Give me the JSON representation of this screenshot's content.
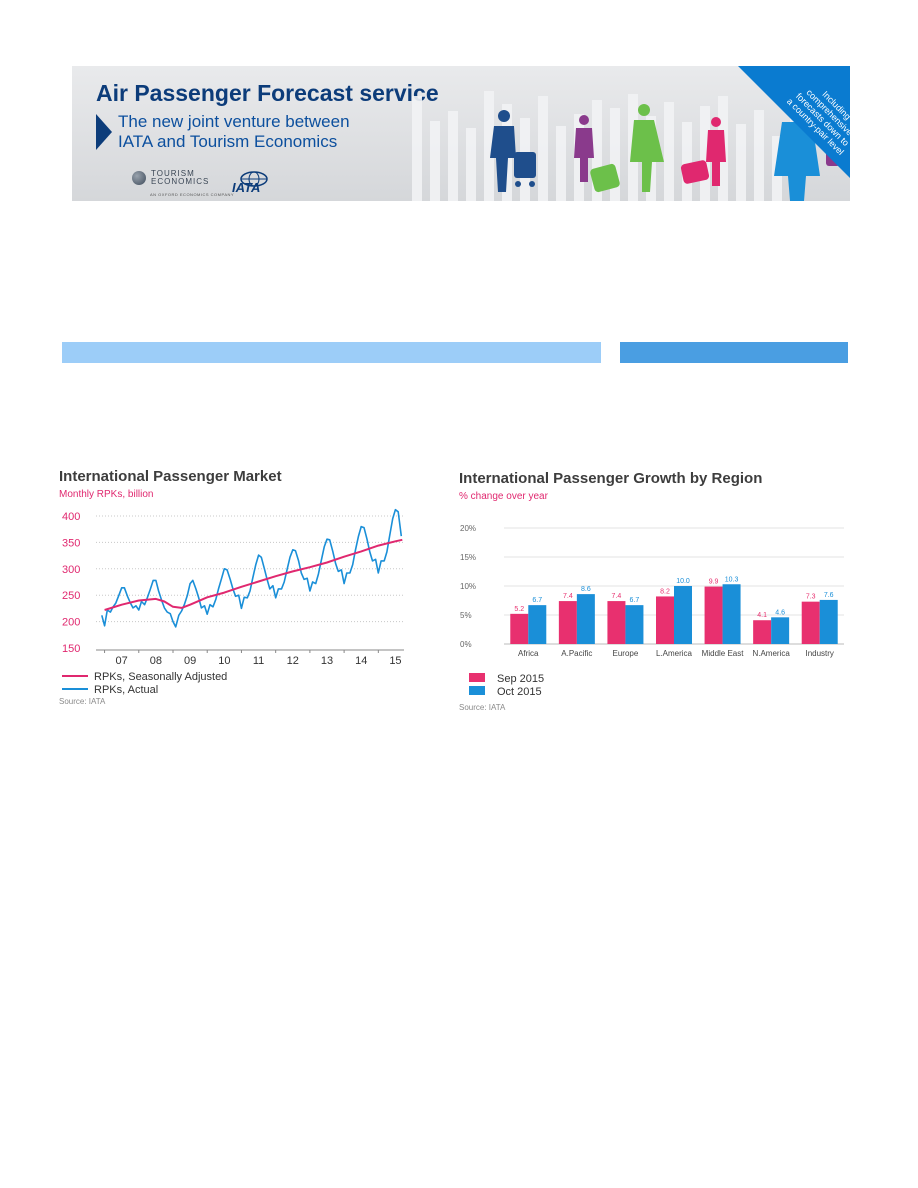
{
  "banner": {
    "title": "Air Passenger Forecast service",
    "subtitle_line1": "The new joint venture between",
    "subtitle_line2": "IATA and Tourism Economics",
    "te_logo_line1": "TOURISM",
    "te_logo_line2": "ECONOMICS",
    "te_logo_tagline": "AN OXFORD ECONOMICS COMPANY",
    "iata_logo": "IATA",
    "corner_lines": [
      "Including",
      "comprehensive",
      "forecasts down to",
      "a country-pair level"
    ],
    "corner_color": "#0a7bd0"
  },
  "section_bars": {
    "left_color": "#9ccdf8",
    "right_color": "#4a9ee2"
  },
  "chart_data": [
    {
      "type": "line",
      "title": "International Passenger Market",
      "subtitle": "Monthly RPKs, billion",
      "ylim": [
        150,
        400
      ],
      "yticks": [
        150,
        200,
        250,
        300,
        350,
        400
      ],
      "xlim": [
        2006.75,
        2015.75
      ],
      "xtick_labels": [
        "07",
        "08",
        "09",
        "10",
        "11",
        "12",
        "13",
        "14",
        "15"
      ],
      "xtick_positions": [
        2007.5,
        2008.5,
        2009.5,
        2010.5,
        2011.5,
        2012.5,
        2013.5,
        2014.5,
        2015.5
      ],
      "grid": true,
      "legend_position": "bottom-left",
      "source": "Source: IATA",
      "series": [
        {
          "name": "RPKs, Seasonally Adjusted",
          "color": "#e0286f",
          "x": [
            2007.0,
            2007.5,
            2008.0,
            2008.5,
            2008.75,
            2009.0,
            2009.25,
            2009.5,
            2010.0,
            2010.5,
            2011.0,
            2011.5,
            2012.0,
            2012.5,
            2013.0,
            2013.5,
            2014.0,
            2014.5,
            2015.0,
            2015.5,
            2015.7
          ],
          "y": [
            222,
            232,
            240,
            243,
            238,
            228,
            226,
            232,
            246,
            255,
            266,
            276,
            286,
            295,
            303,
            312,
            323,
            333,
            344,
            352,
            355
          ]
        },
        {
          "name": "RPKs, Actual",
          "color": "#1a8fd8",
          "x": [
            2006.92,
            2007.0,
            2007.08,
            2007.17,
            2007.25,
            2007.33,
            2007.42,
            2007.5,
            2007.58,
            2007.67,
            2007.75,
            2007.83,
            2007.92,
            2008.0,
            2008.08,
            2008.17,
            2008.25,
            2008.33,
            2008.42,
            2008.5,
            2008.58,
            2008.67,
            2008.75,
            2008.83,
            2008.92,
            2009.0,
            2009.08,
            2009.17,
            2009.25,
            2009.33,
            2009.42,
            2009.5,
            2009.58,
            2009.67,
            2009.75,
            2009.83,
            2009.92,
            2010.0,
            2010.08,
            2010.17,
            2010.25,
            2010.33,
            2010.42,
            2010.5,
            2010.58,
            2010.67,
            2010.75,
            2010.83,
            2010.92,
            2011.0,
            2011.08,
            2011.17,
            2011.25,
            2011.33,
            2011.42,
            2011.5,
            2011.58,
            2011.67,
            2011.75,
            2011.83,
            2011.92,
            2012.0,
            2012.08,
            2012.17,
            2012.25,
            2012.33,
            2012.42,
            2012.5,
            2012.58,
            2012.67,
            2012.75,
            2012.83,
            2012.92,
            2013.0,
            2013.08,
            2013.17,
            2013.25,
            2013.33,
            2013.42,
            2013.5,
            2013.58,
            2013.67,
            2013.75,
            2013.83,
            2013.92,
            2014.0,
            2014.08,
            2014.17,
            2014.25,
            2014.33,
            2014.42,
            2014.5,
            2014.58,
            2014.67,
            2014.75,
            2014.83,
            2014.92,
            2015.0,
            2015.08,
            2015.17,
            2015.25,
            2015.33,
            2015.42,
            2015.5,
            2015.58,
            2015.67
          ],
          "y": [
            212,
            192,
            222,
            218,
            228,
            235,
            250,
            264,
            264,
            248,
            236,
            226,
            230,
            222,
            238,
            232,
            245,
            260,
            278,
            278,
            258,
            240,
            226,
            218,
            215,
            200,
            190,
            212,
            220,
            232,
            250,
            272,
            278,
            262,
            245,
            226,
            230,
            214,
            232,
            228,
            242,
            262,
            282,
            300,
            298,
            280,
            262,
            248,
            250,
            225,
            246,
            245,
            258,
            282,
            308,
            326,
            322,
            300,
            280,
            262,
            268,
            245,
            262,
            262,
            275,
            298,
            322,
            336,
            334,
            315,
            292,
            280,
            282,
            258,
            275,
            272,
            290,
            315,
            342,
            356,
            355,
            333,
            310,
            295,
            298,
            272,
            292,
            292,
            308,
            335,
            362,
            380,
            378,
            356,
            332,
            315,
            318,
            292,
            315,
            315,
            332,
            362,
            395,
            412,
            408,
            362
          ]
        }
      ]
    },
    {
      "type": "bar",
      "title": "International Passenger Growth by Region",
      "subtitle": "% change over year",
      "categories": [
        "Africa",
        "A.Pacific",
        "Europe",
        "L.America",
        "Middle East",
        "N.America",
        "Industry"
      ],
      "ylim": [
        0,
        20
      ],
      "yticks": [
        0,
        5,
        10,
        15,
        20
      ],
      "ytick_labels": [
        "0%",
        "5%",
        "10%",
        "15%",
        "20%"
      ],
      "grid": true,
      "legend_position": "bottom-left",
      "source": "Source: IATA",
      "series": [
        {
          "name": "Sep 2015",
          "color": "#e8306f",
          "values": [
            5.2,
            7.4,
            7.4,
            8.2,
            9.9,
            4.1,
            7.3
          ]
        },
        {
          "name": "Oct 2015",
          "color": "#1a8fd8",
          "values": [
            6.7,
            8.6,
            6.7,
            10.0,
            10.3,
            4.6,
            7.6
          ]
        }
      ]
    }
  ]
}
